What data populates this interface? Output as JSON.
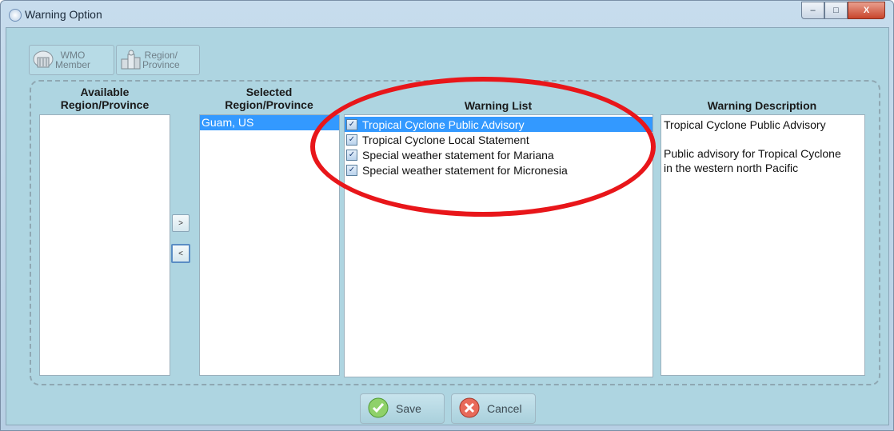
{
  "window": {
    "title": "Warning Option",
    "controls": {
      "minimize": "–",
      "maximize": "□",
      "close": "X"
    }
  },
  "toolbar": {
    "wmo_member": {
      "line1": "WMO",
      "line2": "Member",
      "icon": "globe-building-icon"
    },
    "region_province": {
      "line1": "Region/",
      "line2": "Province",
      "icon": "buildings-icon"
    }
  },
  "columns": {
    "available": {
      "line1": "Available",
      "line2": "Region/Province",
      "items": []
    },
    "selected": {
      "line1": "Selected",
      "line2": "Region/Province",
      "items": [
        "Guam, US"
      ]
    },
    "warning_list": {
      "title": "Warning List",
      "items": [
        {
          "label": "Tropical Cyclone Public Advisory",
          "checked": true
        },
        {
          "label": "Tropical Cyclone Local Statement",
          "checked": true
        },
        {
          "label": "Special weather statement for Mariana",
          "checked": true
        },
        {
          "label": "Special weather statement for Micronesia",
          "checked": true
        }
      ]
    },
    "description": {
      "title": "Warning Description",
      "line1": "Tropical Cyclone Public Advisory",
      "line2": "Public advisory for Tropical Cyclone",
      "line3": "in the western north Pacific"
    }
  },
  "transfer": {
    "add": ">",
    "remove": "<"
  },
  "actions": {
    "save": "Save",
    "cancel": "Cancel"
  },
  "colors": {
    "selection": "#3399ff",
    "highlight_ellipse": "#e8161a",
    "panel": "#aed5e1"
  }
}
